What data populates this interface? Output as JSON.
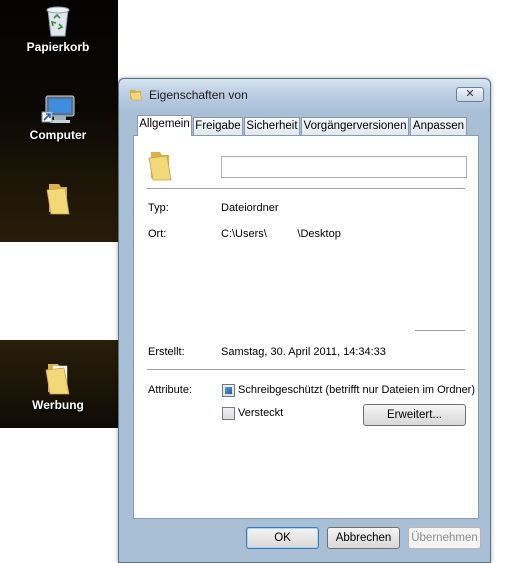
{
  "desktop": {
    "icons": [
      {
        "label": "Papierkorb",
        "icon": "recycle-bin-icon"
      },
      {
        "label": "Computer",
        "icon": "computer-icon"
      },
      {
        "label": "",
        "icon": "folder-icon"
      },
      {
        "label": "Werbung",
        "icon": "folder-icon"
      }
    ]
  },
  "dialog": {
    "title": "Eigenschaften von",
    "close_symbol": "✕",
    "tabs": [
      {
        "label": "Allgemein",
        "active": true
      },
      {
        "label": "Freigabe",
        "active": false
      },
      {
        "label": "Sicherheit",
        "active": false
      },
      {
        "label": "Vorgängerversionen",
        "active": false
      },
      {
        "label": "Anpassen",
        "active": false
      }
    ],
    "general": {
      "name_value": "",
      "type_label": "Typ:",
      "type_value": "Dateiordner",
      "location_label": "Ort:",
      "location_value": "C:\\Users\\          \\Desktop",
      "created_label": "Erstellt:",
      "created_value": "Samstag, 30. April 2011, 14:34:33",
      "attributes_label": "Attribute:",
      "readonly_label": "Schreibgeschützt (betrifft nur Dateien im Ordner)",
      "readonly_state": "indeterminate",
      "hidden_label": "Versteckt",
      "hidden_checked": false,
      "advanced_button": "Erweitert..."
    },
    "buttons": {
      "ok": "OK",
      "cancel": "Abbrechen",
      "apply": "Übernehmen"
    }
  }
}
